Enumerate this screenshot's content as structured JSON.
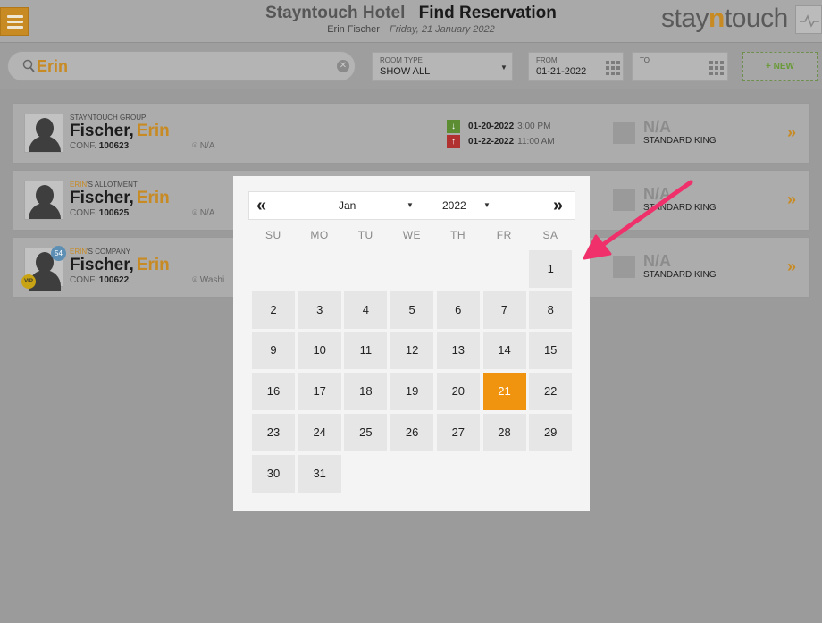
{
  "header": {
    "hotel_name": "Stayntouch Hotel",
    "page_title": "Find Reservation",
    "user_name": "Erin Fischer",
    "date": "Friday, 21 January 2022",
    "logo_prefix": "stay",
    "logo_accent": "n",
    "logo_suffix": "touch"
  },
  "search": {
    "query": "Erin"
  },
  "filters": {
    "room_type": {
      "label": "ROOM TYPE",
      "value": "SHOW ALL"
    },
    "from": {
      "label": "FROM",
      "value": "01-21-2022"
    },
    "to": {
      "label": "TO",
      "value": ""
    },
    "new_button": "+ NEW"
  },
  "reservations": [
    {
      "group_prefix": "",
      "group_rest": "STAYNTOUCH GROUP",
      "last_name": "Fischer,",
      "first_name": "Erin",
      "conf_label": "CONF.",
      "conf_number": "100623",
      "location": "N/A",
      "arrival_date": "01-20-2022",
      "arrival_time": "3:00 PM",
      "departure_date": "01-22-2022",
      "departure_time": "11:00 AM",
      "room": "N/A",
      "room_type": "STANDARD KING"
    },
    {
      "group_prefix": "ERIN",
      "group_rest": "'S ALLOTMENT",
      "last_name": "Fischer,",
      "first_name": "Erin",
      "conf_label": "CONF.",
      "conf_number": "100625",
      "location": "N/A",
      "room": "N/A",
      "room_type": "STANDARD KING"
    },
    {
      "group_prefix": "ERIN",
      "group_rest": "'S COMPANY",
      "last_name": "Fischer,",
      "first_name": "Erin",
      "conf_label": "CONF.",
      "conf_number": "100622",
      "location": "Washi",
      "room": "N/A",
      "room_type": "STANDARD KING",
      "badge_count": "54",
      "vip": "VIP"
    }
  ],
  "calendar": {
    "month": "Jan",
    "year": "2022",
    "weekdays": [
      "SU",
      "MO",
      "TU",
      "WE",
      "TH",
      "FR",
      "SA"
    ],
    "selected_day": "21",
    "days": [
      "1",
      "2",
      "3",
      "4",
      "5",
      "6",
      "7",
      "8",
      "9",
      "10",
      "11",
      "12",
      "13",
      "14",
      "15",
      "16",
      "17",
      "18",
      "19",
      "20",
      "21",
      "22",
      "23",
      "24",
      "25",
      "26",
      "27",
      "28",
      "29",
      "30",
      "31"
    ],
    "prev_symbol": "«",
    "next_symbol": "»"
  },
  "colors": {
    "accent": "#f0940f",
    "brand": "#c88a22",
    "annotation": "#f0306a"
  }
}
